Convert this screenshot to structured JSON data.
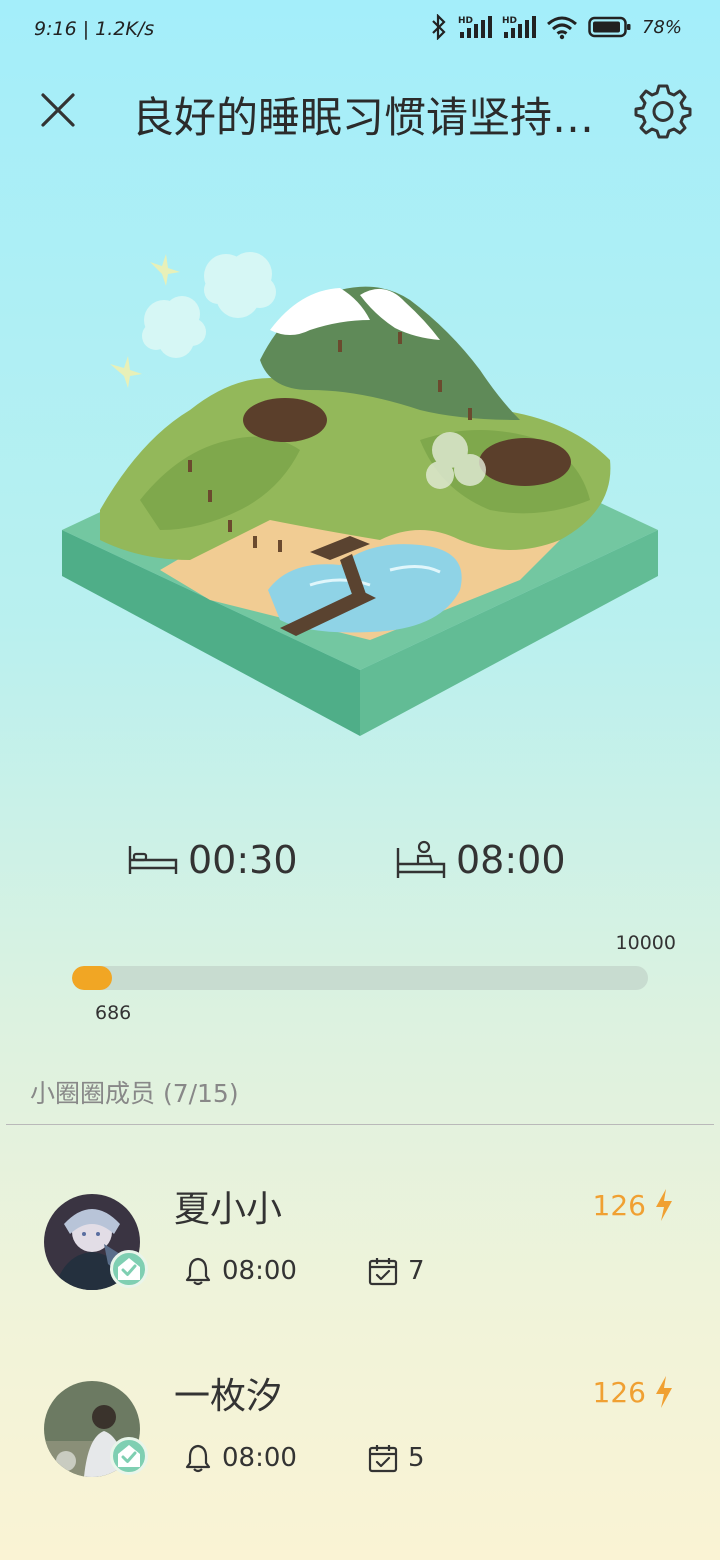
{
  "status": {
    "time_speed": "9:16 | 1.2K/s",
    "battery": "78%"
  },
  "header": {
    "title": "良好的睡眠习惯请坚持…"
  },
  "sleep": {
    "bedtime": "00:30",
    "waketime": "08:00"
  },
  "progress": {
    "max": "10000",
    "current": "686",
    "value": 686,
    "total": 10000
  },
  "members": {
    "header": "小圈圈成员 (7/15)",
    "list": [
      {
        "name": "夏小小",
        "score": "126",
        "alarm": "08:00",
        "days": "7"
      },
      {
        "name": "一枚汐",
        "score": "126",
        "alarm": "08:00",
        "days": "5"
      }
    ]
  },
  "colors": {
    "accent": "#f1a624",
    "score": "#f0a032",
    "badge": "#7fcfb2"
  }
}
